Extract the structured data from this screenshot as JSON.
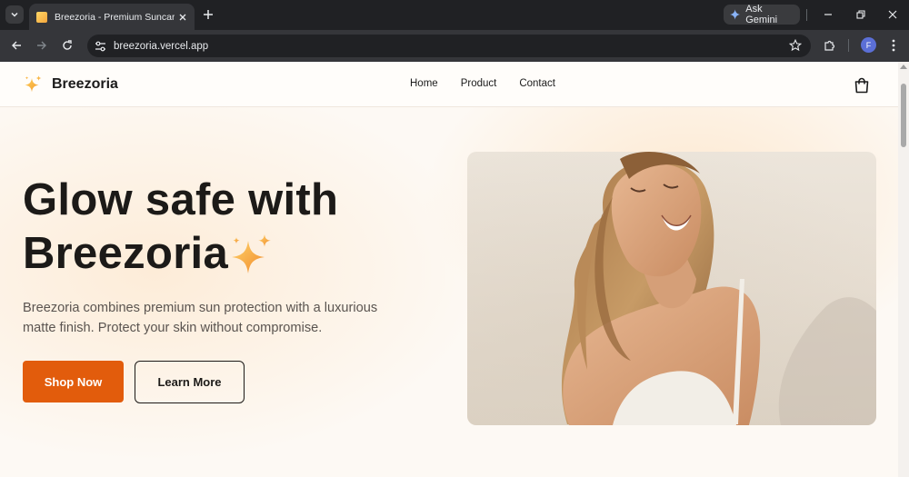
{
  "browser": {
    "tab_title": "Breezoria - Premium Suncare Br",
    "url": "breezoria.vercel.app",
    "gemini_label": "Ask Gemini",
    "profile_initial": "F"
  },
  "site": {
    "brand": "Breezoria",
    "nav": [
      {
        "label": "Home"
      },
      {
        "label": "Product"
      },
      {
        "label": "Contact"
      }
    ]
  },
  "hero": {
    "title_line1": "Glow safe with",
    "title_line2": "Breezoria",
    "description": "Breezoria combines premium sun protection with a luxurious matte finish. Protect your skin without compromise.",
    "primary_button": "Shop Now",
    "secondary_button": "Learn More"
  },
  "colors": {
    "accent": "#e25c0c",
    "text_dark": "#1c1a18",
    "page_bg": "#fdf9f4"
  }
}
